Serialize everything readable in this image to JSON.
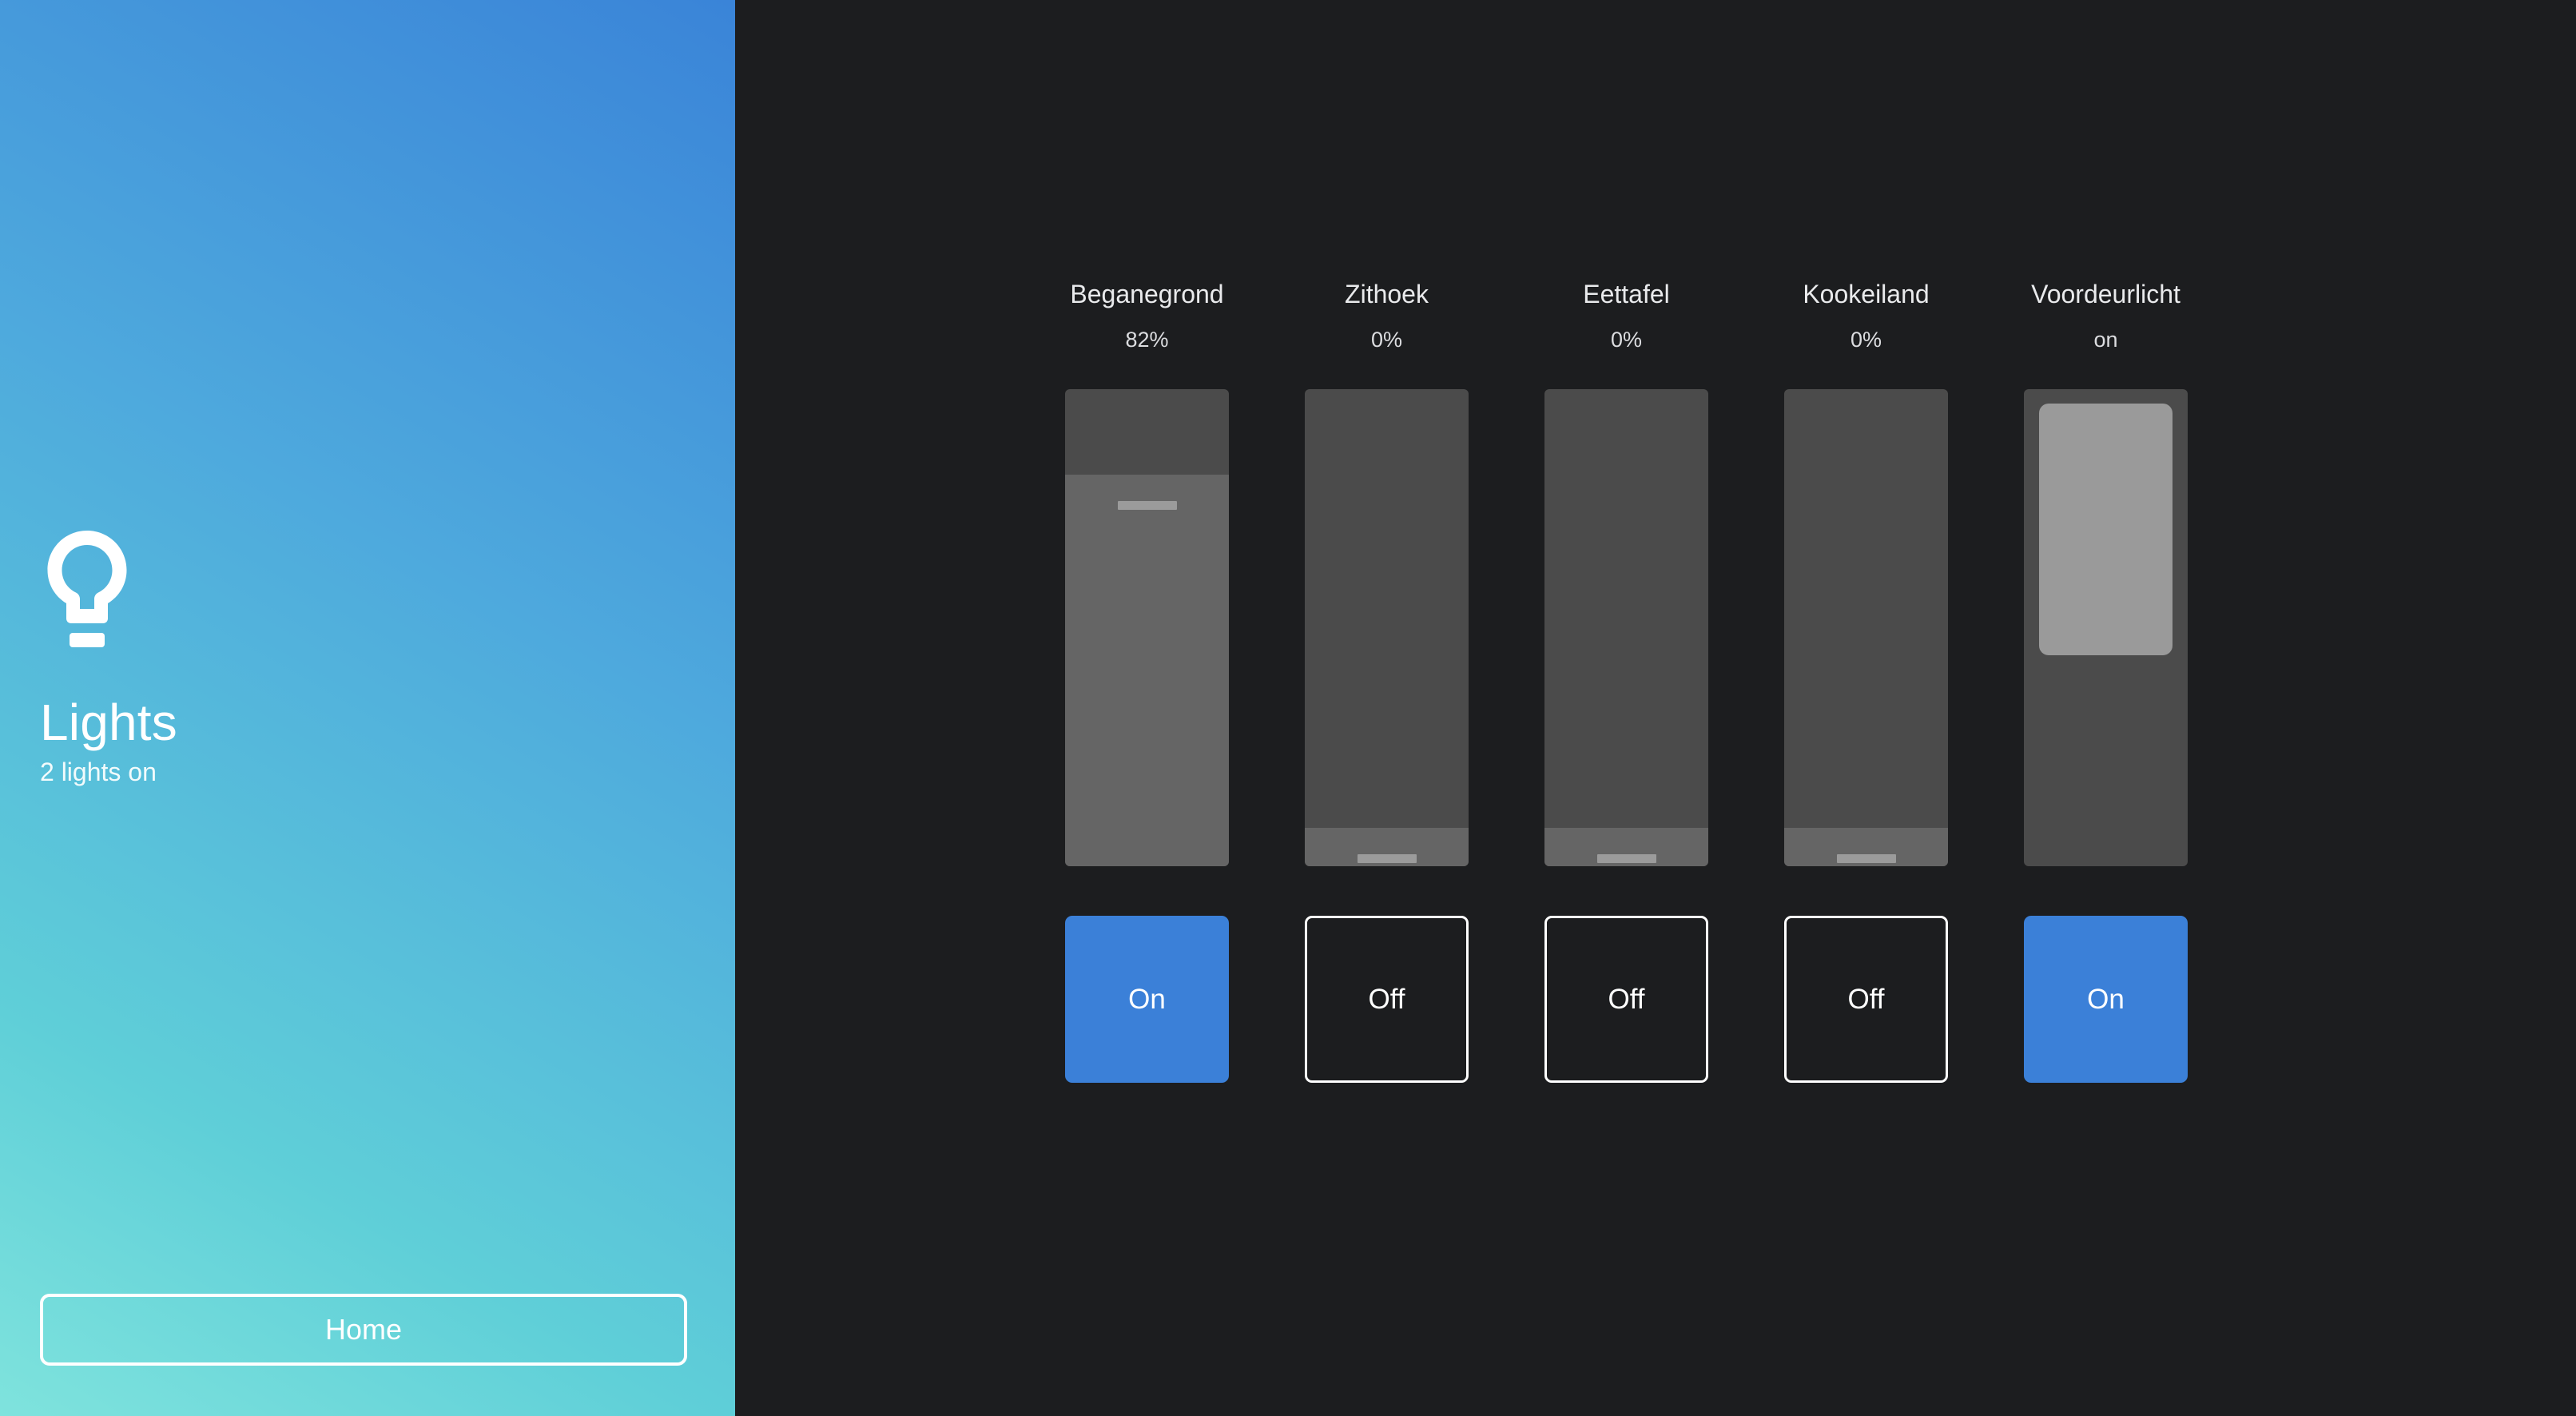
{
  "colors": {
    "accent_blue": "#3b80d8",
    "panel_background": "#1c1d1f",
    "slider_track": "#4b4b4b",
    "slider_fill": "#656565",
    "slider_handle": "#9b9b9b",
    "toggle_knob": "#9a9a9a",
    "gradient_start": "#7fe3dd",
    "gradient_end": "#3a84d8"
  },
  "sidebar": {
    "icon": "lightbulb-icon",
    "title": "Lights",
    "subtitle": "2 lights on",
    "home_button_label": "Home"
  },
  "lights": [
    {
      "name": "Beganegrond",
      "state_label": "82%",
      "control_type": "dimmer",
      "brightness_percent": 82,
      "button_label": "On",
      "is_on": true
    },
    {
      "name": "Zithoek",
      "state_label": "0%",
      "control_type": "dimmer",
      "brightness_percent": 0,
      "button_label": "Off",
      "is_on": false
    },
    {
      "name": "Eettafel",
      "state_label": "0%",
      "control_type": "dimmer",
      "brightness_percent": 0,
      "button_label": "Off",
      "is_on": false
    },
    {
      "name": "Kookeiland",
      "state_label": "0%",
      "control_type": "dimmer",
      "brightness_percent": 0,
      "button_label": "Off",
      "is_on": false
    },
    {
      "name": "Voordeurlicht",
      "state_label": "on",
      "control_type": "switch",
      "brightness_percent": null,
      "button_label": "On",
      "is_on": true
    }
  ]
}
